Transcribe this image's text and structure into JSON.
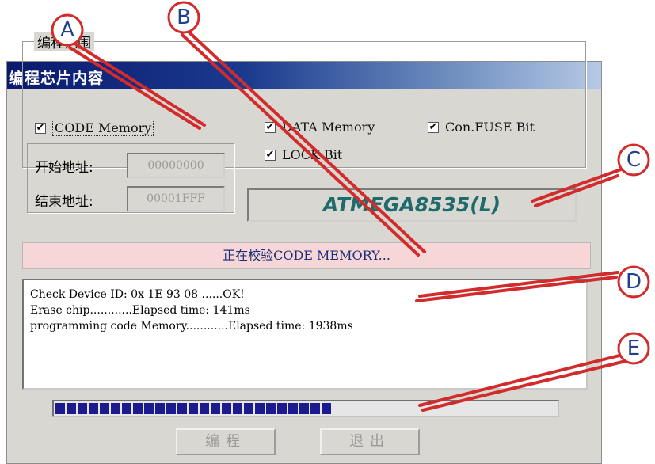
{
  "window": {
    "title": "编程芯片内容"
  },
  "range_group": {
    "legend": "编程范围",
    "code_memory": {
      "label": "CODE Memory",
      "checked": true
    },
    "data_memory": {
      "label": "DATA Memory",
      "checked": true
    },
    "con_fuse": {
      "label": "Con.FUSE Bit",
      "checked": true
    },
    "lock_bit": {
      "label": "LOCK Bit",
      "checked": true
    },
    "start_address": {
      "label": "开始地址:",
      "value": "00000000"
    },
    "end_address": {
      "label": "结束地址:",
      "value": "00001FFF"
    }
  },
  "chip": {
    "name": "ATMEGA8535(L)",
    "color": "#1f6b6b"
  },
  "status": {
    "text": "正在校验CODE MEMORY..."
  },
  "log": {
    "lines": [
      "Check Device ID: 0x 1E 93 08 ......OK!",
      "Erase chip............Elapsed time: 141ms",
      "programming code Memory............Elapsed time: 1938ms"
    ]
  },
  "progress": {
    "segments_filled": 25,
    "fraction": 0.55,
    "color": "#1b1b8f"
  },
  "buttons": {
    "program": "编程",
    "exit": "退出"
  },
  "callouts": {
    "a": "A",
    "b": "B",
    "c": "C",
    "d": "D",
    "e": "E",
    "color": "#d22b2b"
  },
  "check_mark": "✔"
}
